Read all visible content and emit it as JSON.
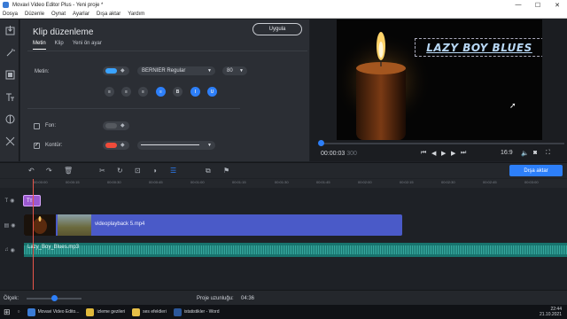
{
  "window": {
    "title": "Movavi Video Editor Plus - Yeni proje *",
    "minimize": "—",
    "maximize": "☐",
    "close": "✕"
  },
  "menu": [
    "Dosya",
    "Düzenle",
    "Oynat",
    "Ayarlar",
    "Dışa aktar",
    "Yardım"
  ],
  "sidebar_tools": [
    "import-icon",
    "magic-wand-icon",
    "filters-icon",
    "titles-icon",
    "transitions-icon",
    "more-tools-icon"
  ],
  "panel": {
    "heading": "Klip düzenleme",
    "apply_label": "Uygula",
    "tabs": [
      "Metin",
      "Klip",
      "Yeni ön ayar"
    ],
    "text_label": "Metin:",
    "font_value": "BERNIER Regular",
    "size_value": "80",
    "fill_label": "Fon:",
    "outline_label": "Kontür:",
    "format_buttons": [
      "≡",
      "≡",
      "≡",
      "≡",
      "B",
      "I",
      "U"
    ],
    "colors": {
      "text": "#3aa3ff",
      "fill": "#6b6f76",
      "outline": "#f04b3a",
      "accent": "#2d7ff9"
    }
  },
  "preview": {
    "title_text": "LAZY BOY BLUES",
    "timecode": "00:00:03",
    "timecode_frames": "300",
    "aspect": "16:9",
    "progress": 0.0
  },
  "toolbar": {
    "export_label": "Dışa aktar"
  },
  "ruler": [
    "00:00:00",
    "00:00:15",
    "00:00:30",
    "00:00:45",
    "00:01:00",
    "00:01:15",
    "00:01:30",
    "00:01:45",
    "00:02:00",
    "00:02:15",
    "00:02:30",
    "00:02:45",
    "00:03:00"
  ],
  "timeline": {
    "title_clip": "Tт",
    "video_clip": "videoplayback 5.mp4",
    "audio_clip": "Lazy_Boy_Blues.mp3"
  },
  "status": {
    "scale_label": "Ölçek:",
    "duration_label": "Proje uzunluğu:",
    "duration": "04:36"
  },
  "taskbar": {
    "items": [
      "Movavi Video Edito...",
      "izleme gezileri",
      "ses efektleri",
      "istatistikler - Word"
    ],
    "clock": "22:44",
    "date": "21.10.2021"
  }
}
